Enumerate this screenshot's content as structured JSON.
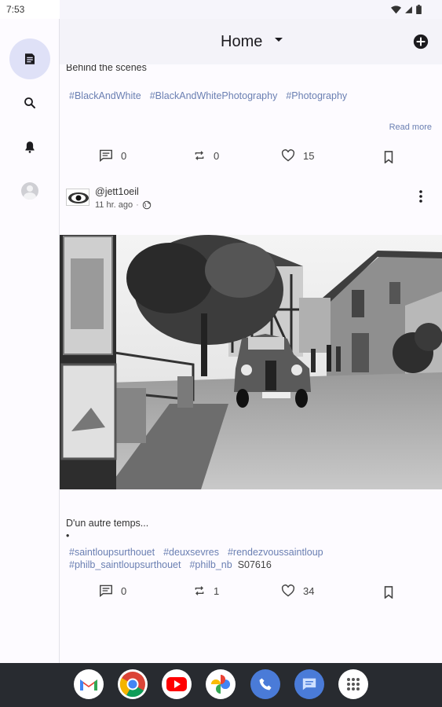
{
  "status_bar": {
    "time": "7:53"
  },
  "header": {
    "title": "Home"
  },
  "nav_rail": {
    "items": [
      {
        "name": "home",
        "icon": "feed-icon",
        "active": true
      },
      {
        "name": "search",
        "icon": "search-icon",
        "active": false
      },
      {
        "name": "notifications",
        "icon": "bell-icon",
        "active": false
      },
      {
        "name": "profile",
        "icon": "avatar-icon",
        "active": false
      }
    ]
  },
  "posts": [
    {
      "text": "Behind the scenes",
      "tags": [
        "#BlackAndWhite",
        "#BlackAndWhitePhotography",
        "#Photography"
      ],
      "read_more": "Read more",
      "replies": "0",
      "boosts": "0",
      "favourites": "15"
    },
    {
      "author": "@jett1oeil",
      "time": "11 hr. ago",
      "visibility_icon": "globe-icon",
      "text": "D'un autre temps...",
      "bullet": "•",
      "tags": [
        "#saintloupsurthouet",
        "#deuxsevres",
        "#rendezvoussaintloup",
        "#philb_saintloupsurthouet",
        "#philb_nb"
      ],
      "tag_suffix": "S07616",
      "replies": "0",
      "boosts": "1",
      "favourites": "34"
    }
  ],
  "dock": {
    "apps": [
      "gmail-icon",
      "chrome-icon",
      "youtube-icon",
      "photos-icon",
      "phone-icon",
      "messages-icon",
      "app-drawer-icon"
    ]
  },
  "colors": {
    "accent": "#dfe1f7",
    "link": "#6a7fb2",
    "dock": "#282b30"
  }
}
